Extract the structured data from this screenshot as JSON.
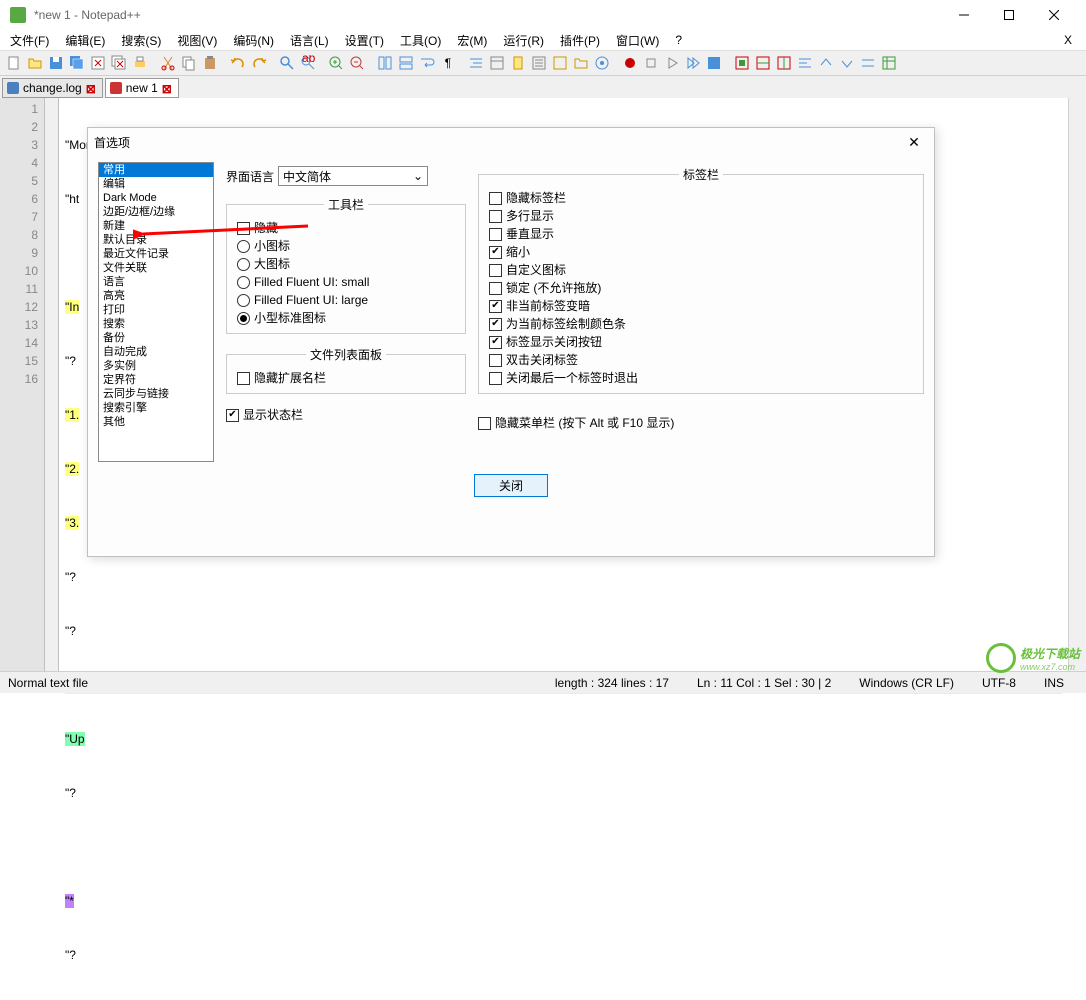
{
  "title": "*new 1 - Notepad++",
  "menus": [
    "文件(F)",
    "编辑(E)",
    "搜索(S)",
    "视图(V)",
    "编码(N)",
    "语言(L)",
    "设置(T)",
    "工具(O)",
    "宏(M)",
    "运行(R)",
    "插件(P)",
    "窗口(W)",
    "?"
  ],
  "tabs": [
    {
      "label": " change.log"
    },
    {
      "label": " new 1"
    }
  ],
  "gutter": [
    "1",
    "2",
    "3",
    "4",
    "5",
    "6",
    "7",
    "8",
    "9",
    "10",
    "11",
    "12",
    "13",
    "14",
    "15",
    "16"
  ],
  "editor": {
    "l1": "\"More fixes & implementations detail:?",
    "l2": "\"ht",
    "l4a": "\"In",
    "l6a": "\"1.",
    "l7a": "\"2.",
    "l8a": "\"3.",
    "q": "\"?",
    "l12a": "\"Up",
    "l15a": "\"*"
  },
  "dialog": {
    "title": "首选项",
    "list": [
      "常用",
      "编辑",
      "Dark Mode",
      "边距/边框/边缘",
      "新建",
      "默认目录",
      "最近文件记录",
      "文件关联",
      "语言",
      "高亮",
      "打印",
      "搜索",
      "备份",
      "自动完成",
      "多实例",
      "定界符",
      "云同步与链接",
      "搜索引擎",
      "其他"
    ],
    "lang_label": "界面语言",
    "lang_value": "中文简体",
    "fs_toolbar": "工具栏",
    "fs_filepanel": "文件列表面板",
    "fs_tabbar": "标签栏",
    "rdo": [
      "隐藏",
      "小图标",
      "大图标",
      "Filled Fluent UI: small",
      "Filled Fluent UI: large",
      "小型标准图标"
    ],
    "chk_hideext": "隐藏扩展名栏",
    "chk_showstatus": "显示状态栏",
    "chk_hidemenu": "隐藏菜单栏 (按下 Alt 或 F10 显示)",
    "tabchk": [
      "隐藏标签栏",
      "多行显示",
      "垂直显示",
      "缩小",
      "自定义图标",
      "锁定 (不允许拖放)",
      "非当前标签变暗",
      "为当前标签绘制颜色条",
      "标签显示关闭按钮",
      "双击关闭标签",
      "关闭最后一个标签时退出"
    ],
    "btn_close": "关闭"
  },
  "status": {
    "filetype": "Normal text file",
    "length": "length : 324    lines : 17",
    "pos": "Ln : 11    Col : 1    Sel : 30 | 2",
    "eol": "Windows (CR LF)",
    "enc": "UTF-8",
    "mode": "INS"
  },
  "watermark": {
    "brand": "极光下载站",
    "url": "www.xz7.com"
  }
}
